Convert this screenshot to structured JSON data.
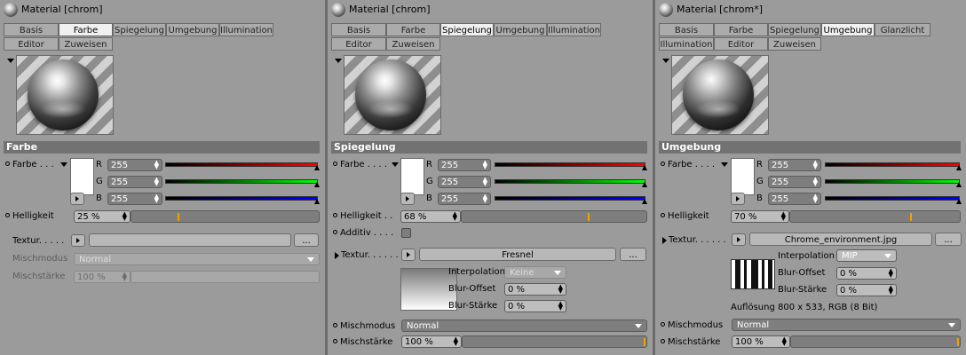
{
  "panel1": {
    "title": "Material [chrom]",
    "tabs_row1": [
      "Basis",
      "Farbe",
      "Spiegelung",
      "Umgebung",
      "Illumination"
    ],
    "tabs_row2": [
      "Editor",
      "Zuweisen"
    ],
    "active_tab": "Farbe",
    "section": "Farbe",
    "color_label": "Farbe . . .",
    "r_label": "R",
    "g_label": "G",
    "b_label": "B",
    "r": "255",
    "g": "255",
    "b": "255",
    "brightness_label": "Helligkeit",
    "brightness": "25 %",
    "brightness_level": 0.25,
    "texture_label": "Textur. . . . .",
    "texture_more": "...",
    "mix_mode_label": "Mischmodus",
    "mix_mode": "Normal",
    "mix_strength_label": "Mischstärke",
    "mix_strength": "100 %"
  },
  "panel2": {
    "title": "Material [chrom]",
    "tabs_row1": [
      "Basis",
      "Farbe",
      "Spiegelung",
      "Umgebung",
      "Illumination"
    ],
    "tabs_row2": [
      "Editor",
      "Zuweisen"
    ],
    "active_tab": "Spiegelung",
    "section": "Spiegelung",
    "color_label": "Farbe . . . .",
    "r_label": "R",
    "g_label": "G",
    "b_label": "B",
    "r": "255",
    "g": "255",
    "b": "255",
    "brightness_label": "Helligkeit . .",
    "brightness": "68 %",
    "brightness_level": 0.68,
    "additive_label": "Additiv . . . .",
    "texture_label": "Textur. . . . . . .",
    "texture_name": "Fresnel",
    "texture_more": "...",
    "interpolation_label": "Interpolation",
    "interpolation": "Keine",
    "blur_offset_label": "Blur-Offset",
    "blur_offset": "0 %",
    "blur_strength_label": "Blur-Stärke",
    "blur_strength": "0 %",
    "mix_mode_label": "Mischmodus",
    "mix_mode": "Normal",
    "mix_strength_label": "Mischstärke",
    "mix_strength": "100 %"
  },
  "panel3": {
    "title": "Material [chrom*]",
    "tabs_row1": [
      "Basis",
      "Farbe",
      "Spiegelung",
      "Umgebung",
      "Glanzlicht"
    ],
    "tabs_row2": [
      "Illumination",
      "Editor",
      "Zuweisen"
    ],
    "active_tab": "Umgebung",
    "section": "Umgebung",
    "color_label": "Farbe . . . .",
    "r_label": "R",
    "g_label": "G",
    "b_label": "B",
    "r": "255",
    "g": "255",
    "b": "255",
    "brightness_label": "Helligkeit",
    "brightness": "70 %",
    "brightness_level": 0.7,
    "texture_label": "Textur. . . . . .",
    "texture_name": "Chrome_environment.jpg",
    "texture_more": "...",
    "interpolation_label": "Interpolation",
    "interpolation": "MIP",
    "blur_offset_label": "Blur-Offset",
    "blur_offset": "0 %",
    "blur_strength_label": "Blur-Stärke",
    "blur_strength": "0 %",
    "resolution": "Auflösung 800 x 533, RGB (8 Bit)",
    "mix_mode_label": "Mischmodus",
    "mix_mode": "Normal",
    "mix_strength_label": "Mischstärke",
    "mix_strength": "100 %"
  },
  "colors": {
    "panel_bg": "#9b9b9b",
    "section_bg": "#727272",
    "field_bg": "#7e7e7e",
    "marker_orange": "#f0a000",
    "red": "#ff0000",
    "green": "#00ff00",
    "blue": "#0000ff"
  }
}
